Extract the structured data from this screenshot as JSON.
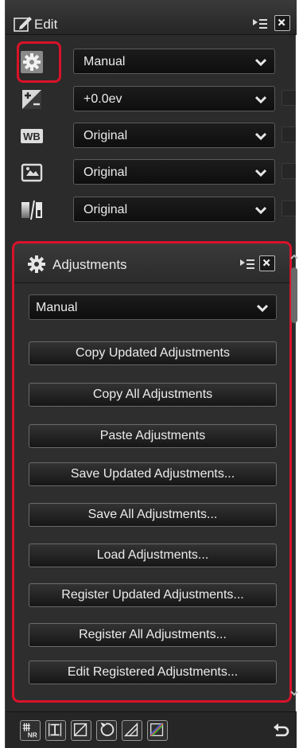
{
  "edit_panel": {
    "title": "Edit",
    "title_icon": "edit-icon",
    "menu_icon": "panel-menu-icon",
    "close_icon": "close-icon",
    "rows": [
      {
        "icon": "gear-icon",
        "value": "Manual",
        "has_checkbox": false
      },
      {
        "icon": "exposure-compensation-icon",
        "value": "+0.0ev",
        "has_checkbox": true
      },
      {
        "icon": "white-balance-icon",
        "icon_text": "WB",
        "value": "Original",
        "has_checkbox": true
      },
      {
        "icon": "picture-control-icon",
        "value": "Original",
        "has_checkbox": true
      },
      {
        "icon": "active-d-lighting-icon",
        "value": "Original",
        "has_checkbox": true
      }
    ]
  },
  "adjustments_panel": {
    "title": "Adjustments",
    "preset": "Manual",
    "buttons": [
      "Copy Updated Adjustments",
      "Copy All Adjustments",
      "Paste Adjustments",
      "Save Updated Adjustments...",
      "Save All Adjustments...",
      "Load Adjustments...",
      "Register Updated Adjustments...",
      "Register All Adjustments...",
      "Edit Registered Adjustments..."
    ]
  },
  "bottom_toolbar": {
    "tools": [
      "noise-reduction-icon",
      "straighten-icon",
      "levels-icon",
      "rotate-icon",
      "perspective-icon",
      "color-curve-icon"
    ],
    "undo_icon": "undo-icon",
    "tool_text": {
      "nr": "NR"
    }
  },
  "colors": {
    "highlight": "#d9122a",
    "panel_bg": "#2b2b2b",
    "text": "#e8e8e8"
  }
}
